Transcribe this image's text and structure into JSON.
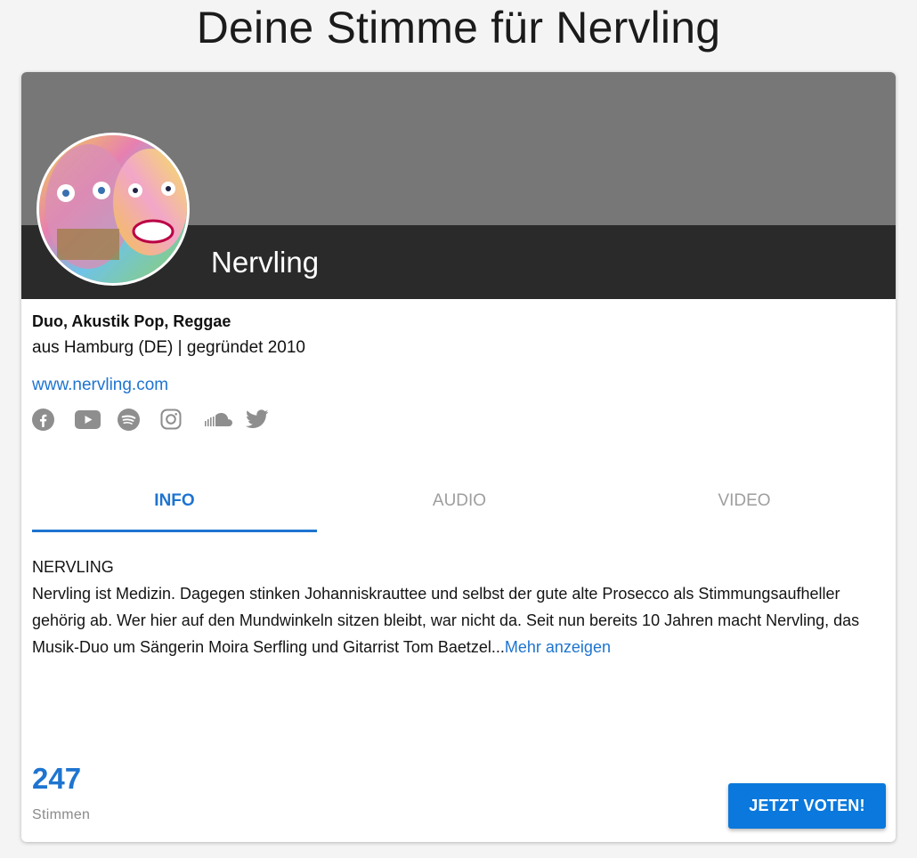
{
  "page": {
    "title": "Deine Stimme für Nervling"
  },
  "band": {
    "name": "Nervling",
    "genre": "Duo, Akustik Pop, Reggae",
    "origin": "aus Hamburg (DE) | gegründet 2010",
    "website": "www.nervling.com"
  },
  "socials": [
    {
      "icon": "facebook-icon"
    },
    {
      "icon": "youtube-icon"
    },
    {
      "icon": "spotify-icon"
    },
    {
      "icon": "instagram-icon"
    },
    {
      "icon": "soundcloud-icon"
    },
    {
      "icon": "twitter-icon"
    }
  ],
  "tabs": [
    {
      "label": "INFO",
      "active": true
    },
    {
      "label": "AUDIO",
      "active": false
    },
    {
      "label": "VIDEO",
      "active": false
    }
  ],
  "description": {
    "heading": "NERVLING",
    "text": "Nervling ist Medizin. Dagegen stinken Johanniskrauttee und selbst der gute alte Prosecco als Stimmungsaufheller gehörig ab. Wer hier auf den Mundwinkeln sitzen bleibt, war nicht da. Seit nun bereits 10 Jahren macht Nervling, das Musik-Duo um Sängerin Moira Serfling und Gitarrist Tom Baetzel...",
    "more_label": "Mehr anzeigen"
  },
  "votes": {
    "count": "247",
    "label": "Stimmen"
  },
  "vote_button": {
    "label": "JETZT VOTEN!"
  },
  "colors": {
    "accent": "#1e74d0",
    "button": "#0a78dc",
    "hero_top": "#777777",
    "hero_bar": "#2a2a2a"
  }
}
